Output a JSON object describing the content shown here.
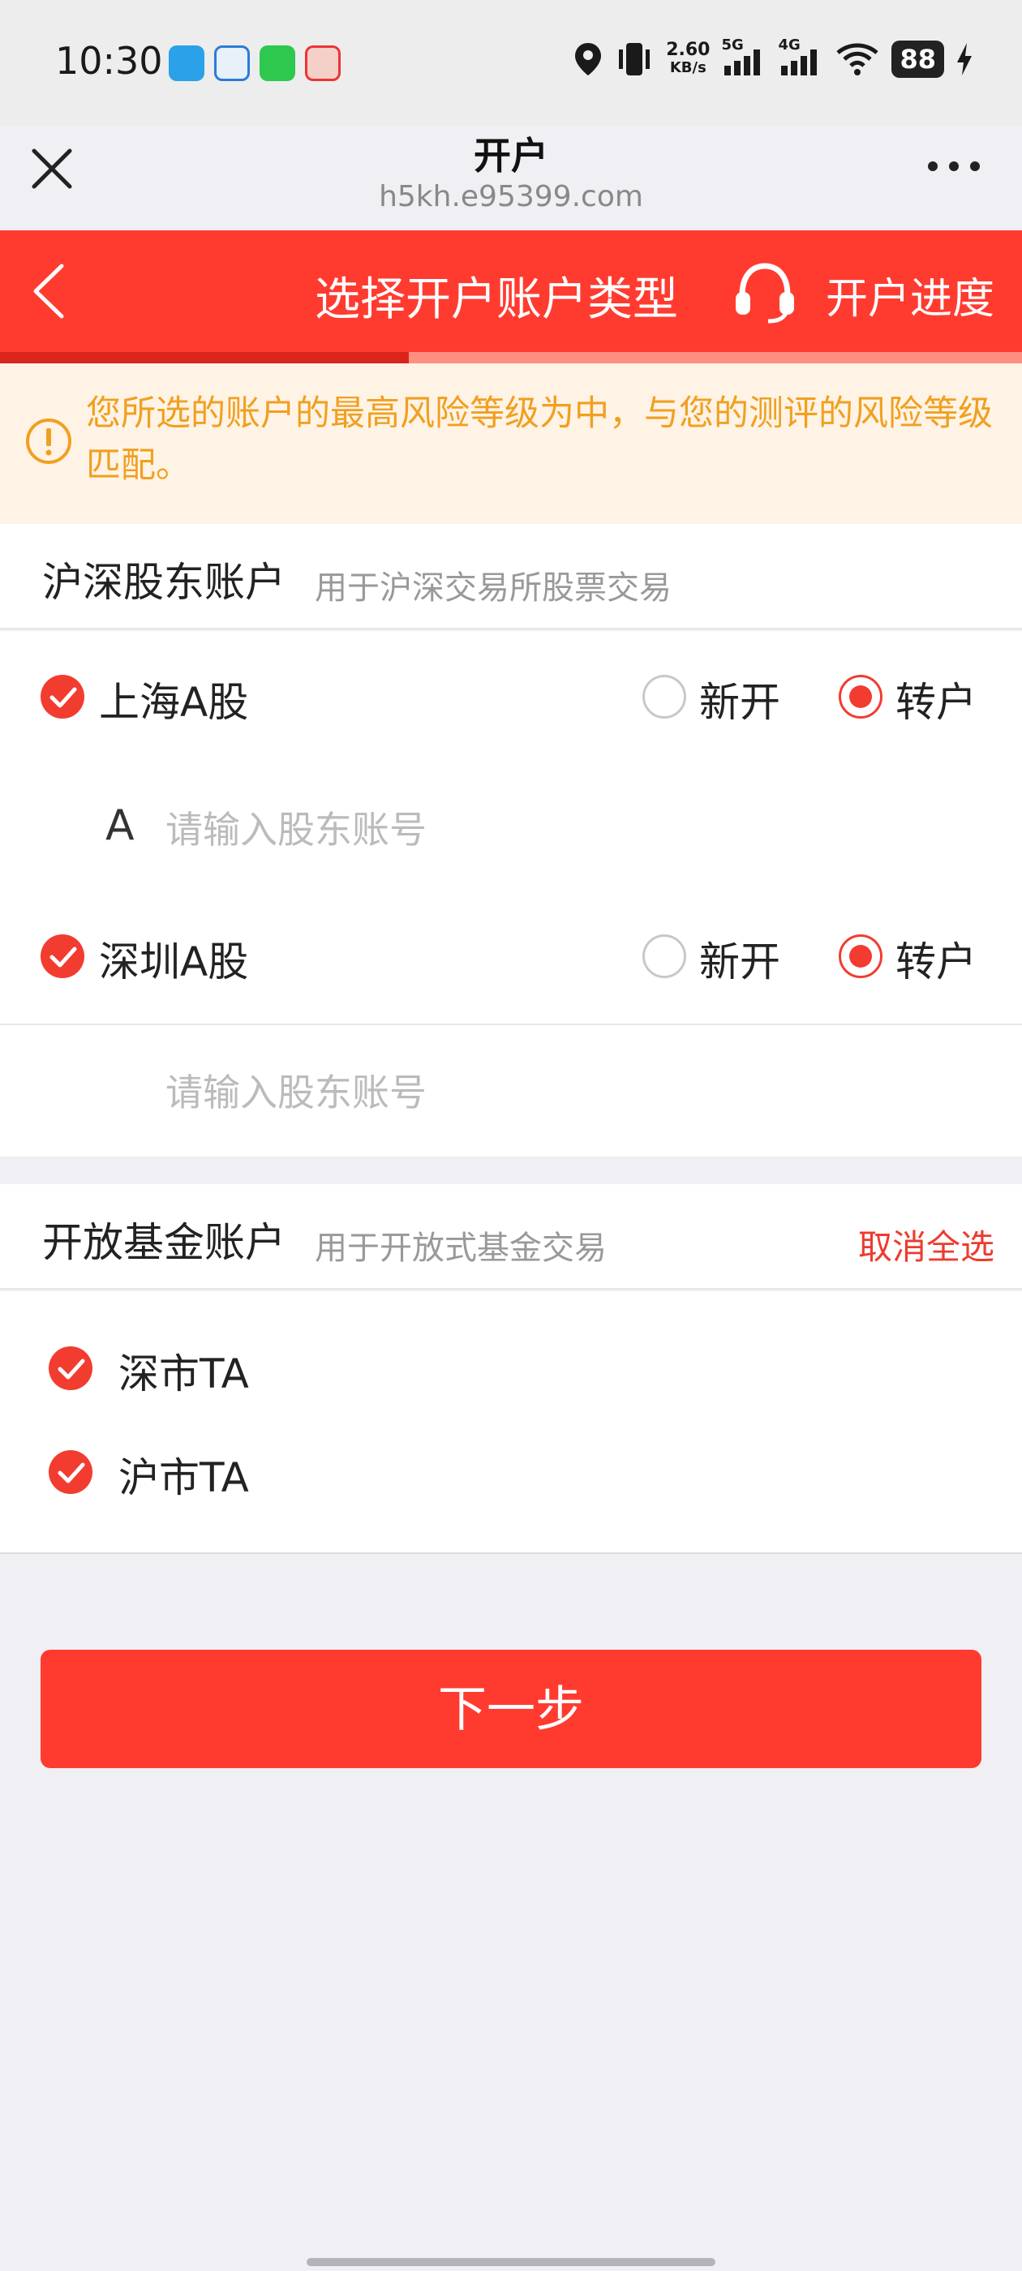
{
  "status_bar": {
    "time": "10:30",
    "net_speed_value": "2.60",
    "net_speed_unit": "KB/s",
    "signal_1": "5G",
    "signal_2": "4G",
    "battery": "88"
  },
  "browser": {
    "title": "开户",
    "url": "h5kh.e95399.com",
    "icons": [
      "close-icon",
      "more-icon"
    ]
  },
  "header": {
    "title": "选择开户账户类型",
    "progress_link": "开户进度",
    "icons": [
      "back-icon",
      "headset-icon"
    ],
    "step_progress": 0.4
  },
  "notice": {
    "text": "您所选的账户的最高风险等级为中，与您的测评的风险等级匹配。"
  },
  "stock_section": {
    "title": "沪深股东账户",
    "desc": "用于沪深交易所股票交易",
    "items": [
      {
        "label": "上海A股",
        "checked": true,
        "option_new": "新开",
        "option_transfer": "转户",
        "selected": "转户",
        "input_prefix": "A",
        "input_placeholder": "请输入股东账号"
      },
      {
        "label": "深圳A股",
        "checked": true,
        "option_new": "新开",
        "option_transfer": "转户",
        "selected": "转户",
        "input_prefix": "",
        "input_placeholder": "请输入股东账号"
      }
    ]
  },
  "fund_section": {
    "title": "开放基金账户",
    "desc": "用于开放式基金交易",
    "deselect_all": "取消全选",
    "items": [
      {
        "label": "深市TA",
        "checked": true
      },
      {
        "label": "沪市TA",
        "checked": true
      }
    ]
  },
  "next_button": "下一步",
  "colors": {
    "primary": "#ff3b30",
    "notice_text": "#f0a020",
    "notice_bg": "#fff3e6"
  }
}
